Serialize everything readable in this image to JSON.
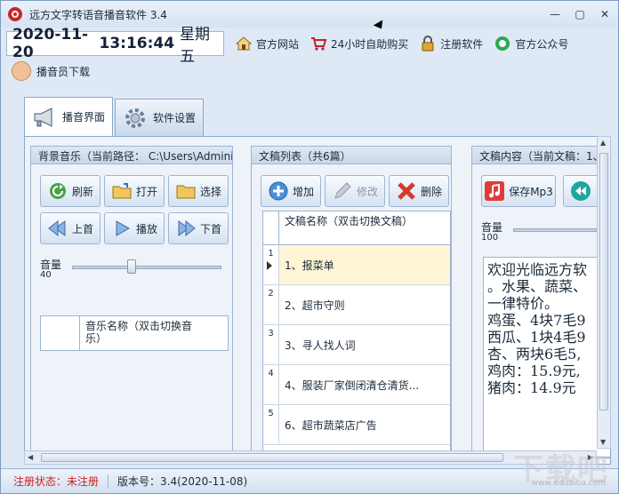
{
  "window": {
    "title": "远方文字转语音播音软件 3.4"
  },
  "toolbar": {
    "date": "2020-11-20",
    "time": "13:16:44",
    "weekday": "星期五",
    "links": [
      {
        "label": "官方网站",
        "icon": "home-icon"
      },
      {
        "label": "24小时自助购买",
        "icon": "cart-icon"
      },
      {
        "label": "注册软件",
        "icon": "lock-icon"
      },
      {
        "label": "官方公众号",
        "icon": "wechat-icon"
      }
    ],
    "announcer_download": "播音员下载"
  },
  "tabs": [
    {
      "label": "播音界面",
      "active": true,
      "icon": "megaphone-icon"
    },
    {
      "label": "软件设置",
      "active": false,
      "icon": "gear-icon"
    }
  ],
  "music_panel": {
    "header": "背景音乐（当前路径： C:\\Users\\Admini",
    "buttons": {
      "refresh": "刷新",
      "open": "打开",
      "select": "选择",
      "prev": "上首",
      "play": "播放",
      "next": "下首"
    },
    "volume_label": "音量",
    "volume_value": "40",
    "volume_level": 40,
    "list_header": "音乐名称（双击切换音乐）"
  },
  "doc_panel": {
    "header": "文稿列表（共6篇）",
    "buttons": {
      "add": "增加",
      "edit": "修改",
      "delete": "删除"
    },
    "list_header": "文稿名称（双击切换文稿）",
    "rows": [
      {
        "num": "1",
        "name": "1、报菜单",
        "selected": true
      },
      {
        "num": "2",
        "name": "2、超市守则",
        "selected": false
      },
      {
        "num": "3",
        "name": "3、寻人找人词",
        "selected": false
      },
      {
        "num": "4",
        "name": "4、服装厂家倒闭清仓清货...",
        "selected": false
      },
      {
        "num": "5",
        "name": "6、超市蔬菜店广告",
        "selected": false
      }
    ]
  },
  "content_panel": {
    "header": "文稿内容（当前文稿：1、",
    "save_mp3": "保存Mp3",
    "volume_label": "音量",
    "volume_value": "100",
    "volume_level": 100,
    "text": "欢迎光临远方软\n。水果、蔬菜、\n一律特价。\n鸡蛋、4块7毛9\n西瓜、1块4毛9\n杏、两块6毛5,\n鸡肉：15.9元,\n猪肉：14.9元"
  },
  "status": {
    "reg_status": "注册状态：未注册",
    "version": "版本号：3.4(2020-11-08)"
  },
  "watermark": {
    "main": "下载吧",
    "sub": "www.xiazaiba.com"
  }
}
